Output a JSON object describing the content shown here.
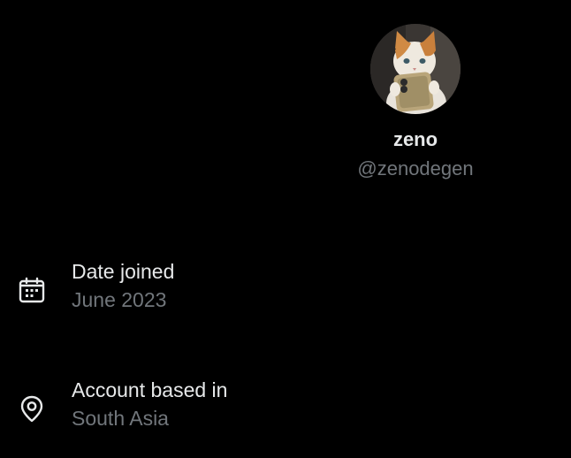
{
  "profile": {
    "avatar_icon": "cat-holding-phone-avatar",
    "display_name": "zeno",
    "handle": "@zenodegen"
  },
  "details": {
    "date_joined": {
      "icon": "calendar-icon",
      "label": "Date joined",
      "value": "June 2023"
    },
    "location": {
      "icon": "location-pin-icon",
      "label": "Account based in",
      "value": "South Asia"
    }
  },
  "colors": {
    "background": "#000000",
    "primary_text": "#e7e9ea",
    "secondary_text": "#71767b"
  }
}
